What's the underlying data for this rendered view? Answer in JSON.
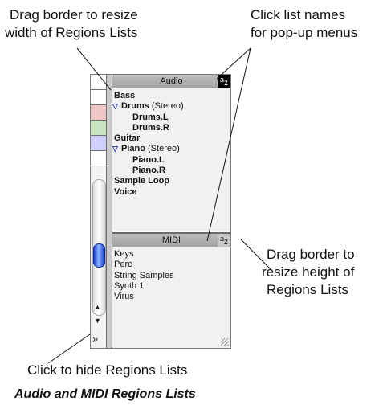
{
  "callouts": {
    "resize_width": [
      "Drag border to resize",
      "width of Regions Lists"
    ],
    "list_names": [
      "Click list names",
      "for pop-up menus"
    ],
    "resize_height": [
      "Drag border to",
      "resize height of",
      "Regions Lists"
    ],
    "hide": "Click to hide Regions Lists"
  },
  "caption": "Audio and MIDI Regions Lists",
  "audio_list": {
    "title": "Audio",
    "sort_icon": [
      "a",
      "z"
    ],
    "items": [
      {
        "name": "Bass"
      },
      {
        "name": "Drums",
        "suffix": "(Stereo)",
        "expanded": true
      },
      {
        "name": "Drums.L",
        "indent": true
      },
      {
        "name": "Drums.R",
        "indent": true
      },
      {
        "name": "Guitar"
      },
      {
        "name": "Piano",
        "suffix": "(Stereo)",
        "expanded": true
      },
      {
        "name": "Piano.L",
        "indent": true
      },
      {
        "name": "Piano.R",
        "indent": true
      },
      {
        "name": "Sample Loop"
      },
      {
        "name": "Voice"
      }
    ]
  },
  "midi_list": {
    "title": "MIDI",
    "sort_icon": [
      "a",
      "z"
    ],
    "items": [
      "Keys",
      "Perc",
      "String Samples",
      "Synth 1",
      "Virus"
    ]
  },
  "track_colors": [
    "#ffffff",
    "#ffffff",
    "#efc6c6",
    "#c7e3c0",
    "#d0d0ff"
  ],
  "controls": {
    "scroll_up": "▲",
    "scroll_down": "▼",
    "hide_icon": "»"
  }
}
